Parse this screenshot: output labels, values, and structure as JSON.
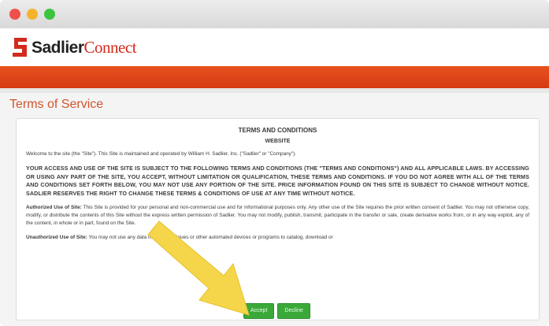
{
  "window": {
    "traffic_lights": [
      "close",
      "minimize",
      "maximize"
    ]
  },
  "brand": {
    "name_part1": "Sadlier",
    "name_part2": "Connect",
    "color": "#d42a1d"
  },
  "page": {
    "title": "Terms of Service",
    "accent": "#d2542a"
  },
  "terms": {
    "heading": "TERMS AND CONDITIONS",
    "subheading": "WEBSITE",
    "intro": "Welcome to the site (the \"Site\"). This Site is maintained and operated by William H. Sadlier, Inc. (\"Sadlier\" or \"Company\").",
    "caps_paragraph": "YOUR ACCESS AND USE OF THE SITE IS SUBJECT TO THE FOLLOWING TERMS AND CONDITIONS (THE \"TERMS AND CONDITIONS\") AND ALL APPLICABLE LAWS. BY ACCESSING OR USING ANY PART OF THE SITE, YOU ACCEPT, WITHOUT LIMITATION OR QUALIFICATION, THESE TERMS AND CONDITIONS. IF YOU DO NOT AGREE WITH ALL OF THE TERMS AND CONDITIONS SET FORTH BELOW, YOU MAY NOT USE ANY PORTION OF THE SITE. PRICE INFORMATION FOUND ON THIS SITE IS SUBJECT TO CHANGE WITHOUT NOTICE. SADLIER RESERVES THE RIGHT TO CHANGE THESE TERMS & CONDITIONS OF USE AT ANY TIME WITHOUT NOTICE.",
    "authorized_label": "Authorized Use of Site:",
    "authorized_text": "This Site is provided for your personal and non-commercial use and for informational purposes only. Any other use of the Site requires the prior written consent of Sadlier. You may not otherwise copy, modify, or distribute the contents of this Site without the express written permission of Sadlier. You may not modify, publish, transmit, participate in the transfer or sale, create derivative works from, or in any way exploit, any of the content, in whole or in part, found on the Site.",
    "unauthorized_label": "Unauthorized Use of Site:",
    "unauthorized_text": "You may not use any data mining techniques or other automated devices or programs to catalog, download or"
  },
  "buttons": {
    "accept": "Accept",
    "decline": "Decline"
  }
}
